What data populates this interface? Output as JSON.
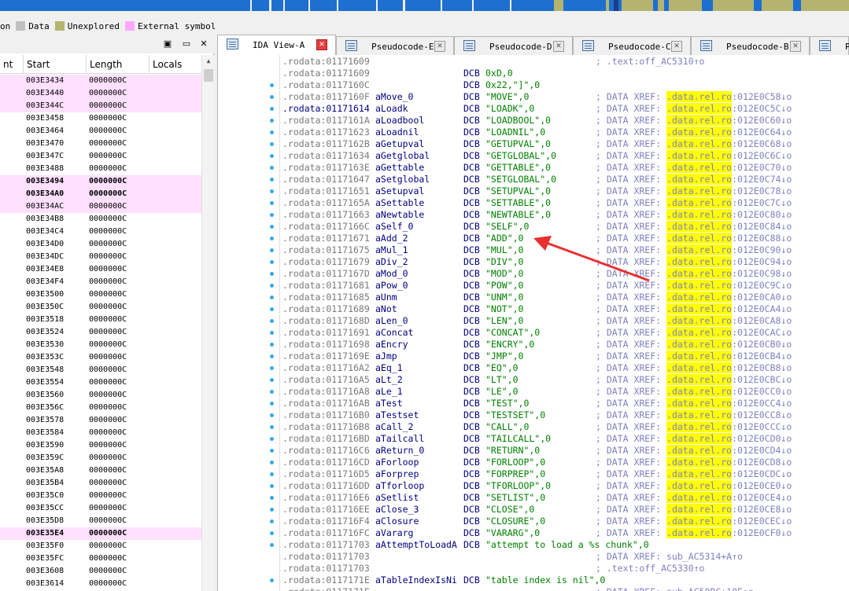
{
  "legend": [
    {
      "label": "on",
      "color": ""
    },
    {
      "label": "Data",
      "color": "#c0c0c0"
    },
    {
      "label": "Unexplored",
      "color": "#b5b370"
    },
    {
      "label": "External symbol",
      "color": "#ffa8ff"
    }
  ],
  "functions_panel": {
    "columns": [
      "nt",
      "Start",
      "Length",
      "Locals"
    ],
    "rows": [
      {
        "start": "003E3434",
        "length": "0000000C",
        "pink": true,
        "bold": false
      },
      {
        "start": "003E3440",
        "length": "0000000C",
        "pink": true,
        "bold": false
      },
      {
        "start": "003E344C",
        "length": "0000000C",
        "pink": true,
        "bold": false
      },
      {
        "start": "003E3458",
        "length": "0000000C",
        "pink": false,
        "bold": false
      },
      {
        "start": "003E3464",
        "length": "0000000C",
        "pink": false,
        "bold": false
      },
      {
        "start": "003E3470",
        "length": "0000000C",
        "pink": false,
        "bold": false
      },
      {
        "start": "003E347C",
        "length": "0000000C",
        "pink": false,
        "bold": false
      },
      {
        "start": "003E3488",
        "length": "0000000C",
        "pink": false,
        "bold": false
      },
      {
        "start": "003E3494",
        "length": "0000000C",
        "pink": true,
        "bold": true
      },
      {
        "start": "003E34A0",
        "length": "0000000C",
        "pink": true,
        "bold": true
      },
      {
        "start": "003E34AC",
        "length": "0000000C",
        "pink": true,
        "bold": false
      },
      {
        "start": "003E34B8",
        "length": "0000000C",
        "pink": false,
        "bold": false
      },
      {
        "start": "003E34C4",
        "length": "0000000C",
        "pink": false,
        "bold": false
      },
      {
        "start": "003E34D0",
        "length": "0000000C",
        "pink": false,
        "bold": false
      },
      {
        "start": "003E34DC",
        "length": "0000000C",
        "pink": false,
        "bold": false
      },
      {
        "start": "003E34E8",
        "length": "0000000C",
        "pink": false,
        "bold": false
      },
      {
        "start": "003E34F4",
        "length": "0000000C",
        "pink": false,
        "bold": false
      },
      {
        "start": "003E3500",
        "length": "0000000C",
        "pink": false,
        "bold": false
      },
      {
        "start": "003E350C",
        "length": "0000000C",
        "pink": false,
        "bold": false
      },
      {
        "start": "003E3518",
        "length": "0000000C",
        "pink": false,
        "bold": false
      },
      {
        "start": "003E3524",
        "length": "0000000C",
        "pink": false,
        "bold": false
      },
      {
        "start": "003E3530",
        "length": "0000000C",
        "pink": false,
        "bold": false
      },
      {
        "start": "003E353C",
        "length": "0000000C",
        "pink": false,
        "bold": false
      },
      {
        "start": "003E3548",
        "length": "0000000C",
        "pink": false,
        "bold": false
      },
      {
        "start": "003E3554",
        "length": "0000000C",
        "pink": false,
        "bold": false
      },
      {
        "start": "003E3560",
        "length": "0000000C",
        "pink": false,
        "bold": false
      },
      {
        "start": "003E356C",
        "length": "0000000C",
        "pink": false,
        "bold": false
      },
      {
        "start": "003E3578",
        "length": "0000000C",
        "pink": false,
        "bold": false
      },
      {
        "start": "003E3584",
        "length": "0000000C",
        "pink": false,
        "bold": false
      },
      {
        "start": "003E3590",
        "length": "0000000C",
        "pink": false,
        "bold": false
      },
      {
        "start": "003E359C",
        "length": "0000000C",
        "pink": false,
        "bold": false
      },
      {
        "start": "003E35A8",
        "length": "0000000C",
        "pink": false,
        "bold": false
      },
      {
        "start": "003E35B4",
        "length": "0000000C",
        "pink": false,
        "bold": false
      },
      {
        "start": "003E35C0",
        "length": "0000000C",
        "pink": false,
        "bold": false
      },
      {
        "start": "003E35CC",
        "length": "0000000C",
        "pink": false,
        "bold": false
      },
      {
        "start": "003E35D8",
        "length": "0000000C",
        "pink": false,
        "bold": false
      },
      {
        "start": "003E35E4",
        "length": "0000000C",
        "pink": true,
        "bold": true
      },
      {
        "start": "003E35F0",
        "length": "0000000C",
        "pink": false,
        "bold": false
      },
      {
        "start": "003E35FC",
        "length": "0000000C",
        "pink": false,
        "bold": false
      },
      {
        "start": "003E3608",
        "length": "0000000C",
        "pink": false,
        "bold": false
      },
      {
        "start": "003E3614",
        "length": "0000000C",
        "pink": false,
        "bold": false
      }
    ]
  },
  "panel_buttons": {
    "menu": "▣",
    "restore": "▭",
    "close": "✕"
  },
  "tabs": [
    {
      "label": "IDA View-A",
      "active": true
    },
    {
      "label": "Pseudocode-E",
      "active": false
    },
    {
      "label": "Pseudocode-D",
      "active": false
    },
    {
      "label": "Pseudocode-C",
      "active": false
    },
    {
      "label": "Pseudocode-B",
      "active": false
    },
    {
      "label": "Pseu",
      "active": false
    }
  ],
  "tab_close_glyph": "✕",
  "listing": [
    {
      "addr": ".rodata:01171609",
      "name": "",
      "ins": "",
      "op": "",
      "xref_pre": "; .text:off_AC5310↑o",
      "xref_hl": "",
      "xref_post": "",
      "bullet": false,
      "cur": false
    },
    {
      "addr": ".rodata:01171609",
      "name": "",
      "ins": "DCB",
      "op": "0xD,0",
      "xref_pre": "",
      "xref_hl": "",
      "xref_post": "",
      "bullet": false,
      "cur": false
    },
    {
      "addr": ".rodata:0117160C",
      "name": "",
      "ins": "DCB",
      "op": "0x22,\"]\",0",
      "xref_pre": "",
      "xref_hl": "",
      "xref_post": "",
      "bullet": true,
      "cur": false
    },
    {
      "addr": ".rodata:0117160F",
      "name": "aMove_0",
      "ins": "DCB",
      "op": "\"MOVE\",0",
      "xref_pre": "; DATA XREF: ",
      "xref_hl": ".data.rel.ro",
      "xref_post": ":012E0C58↓o",
      "bullet": true,
      "cur": false
    },
    {
      "addr": ".rodata:01171614",
      "name": "aLoadk",
      "ins": "DCB",
      "op": "\"LOADK\",0",
      "xref_pre": "; DATA XREF: ",
      "xref_hl": ".data.rel.ro",
      "xref_post": ":012E0C5C↓o",
      "bullet": true,
      "cur": true
    },
    {
      "addr": ".rodata:0117161A",
      "name": "aLoadbool",
      "ins": "DCB",
      "op": "\"LOADBOOL\",0",
      "xref_pre": "; DATA XREF: ",
      "xref_hl": ".data.rel.ro",
      "xref_post": ":012E0C60↓o",
      "bullet": true,
      "cur": false
    },
    {
      "addr": ".rodata:01171623",
      "name": "aLoadnil",
      "ins": "DCB",
      "op": "\"LOADNIL\",0",
      "xref_pre": "; DATA XREF: ",
      "xref_hl": ".data.rel.ro",
      "xref_post": ":012E0C64↓o",
      "bullet": true,
      "cur": false
    },
    {
      "addr": ".rodata:0117162B",
      "name": "aGetupval",
      "ins": "DCB",
      "op": "\"GETUPVAL\",0",
      "xref_pre": "; DATA XREF: ",
      "xref_hl": ".data.rel.ro",
      "xref_post": ":012E0C68↓o",
      "bullet": true,
      "cur": false
    },
    {
      "addr": ".rodata:01171634",
      "name": "aGetglobal",
      "ins": "DCB",
      "op": "\"GETGLOBAL\",0",
      "xref_pre": "; DATA XREF: ",
      "xref_hl": ".data.rel.ro",
      "xref_post": ":012E0C6C↓o",
      "bullet": true,
      "cur": false
    },
    {
      "addr": ".rodata:0117163E",
      "name": "aGettable",
      "ins": "DCB",
      "op": "\"GETTABLE\",0",
      "xref_pre": "; DATA XREF: ",
      "xref_hl": ".data.rel.ro",
      "xref_post": ":012E0C70↓o",
      "bullet": true,
      "cur": false
    },
    {
      "addr": ".rodata:01171647",
      "name": "aSetglobal",
      "ins": "DCB",
      "op": "\"SETGLOBAL\",0",
      "xref_pre": "; DATA XREF: ",
      "xref_hl": ".data.rel.ro",
      "xref_post": ":012E0C74↓o",
      "bullet": true,
      "cur": false
    },
    {
      "addr": ".rodata:01171651",
      "name": "aSetupval",
      "ins": "DCB",
      "op": "\"SETUPVAL\",0",
      "xref_pre": "; DATA XREF: ",
      "xref_hl": ".data.rel.ro",
      "xref_post": ":012E0C78↓o",
      "bullet": true,
      "cur": false
    },
    {
      "addr": ".rodata:0117165A",
      "name": "aSettable",
      "ins": "DCB",
      "op": "\"SETTABLE\",0",
      "xref_pre": "; DATA XREF: ",
      "xref_hl": ".data.rel.ro",
      "xref_post": ":012E0C7C↓o",
      "bullet": true,
      "cur": false
    },
    {
      "addr": ".rodata:01171663",
      "name": "aNewtable",
      "ins": "DCB",
      "op": "\"NEWTABLE\",0",
      "xref_pre": "; DATA XREF: ",
      "xref_hl": ".data.rel.ro",
      "xref_post": ":012E0C80↓o",
      "bullet": true,
      "cur": false
    },
    {
      "addr": ".rodata:0117166C",
      "name": "aSelf_0",
      "ins": "DCB",
      "op": "\"SELF\",0",
      "xref_pre": "; DATA XREF: ",
      "xref_hl": ".data.rel.ro",
      "xref_post": ":012E0C84↓o",
      "bullet": true,
      "cur": false
    },
    {
      "addr": ".rodata:01171671",
      "name": "aAdd_2",
      "ins": "DCB",
      "op": "\"ADD\",0",
      "xref_pre": "; DATA XREF: ",
      "xref_hl": ".data.rel.ro",
      "xref_post": ":012E0C88↓o",
      "bullet": true,
      "cur": false
    },
    {
      "addr": ".rodata:01171675",
      "name": "aMul_1",
      "ins": "DCB",
      "op": "\"MUL\",0",
      "xref_pre": "; DATA XREF: ",
      "xref_hl": ".data.rel.ro",
      "xref_post": ":012E0C90↓o",
      "bullet": true,
      "cur": false
    },
    {
      "addr": ".rodata:01171679",
      "name": "aDiv_2",
      "ins": "DCB",
      "op": "\"DIV\",0",
      "xref_pre": "; DATA XREF: ",
      "xref_hl": ".data.rel.ro",
      "xref_post": ":012E0C94↓o",
      "bullet": true,
      "cur": false
    },
    {
      "addr": ".rodata:0117167D",
      "name": "aMod_0",
      "ins": "DCB",
      "op": "\"MOD\",0",
      "xref_pre": "; DATA XREF: ",
      "xref_hl": ".data.rel.ro",
      "xref_post": ":012E0C98↓o",
      "bullet": true,
      "cur": false
    },
    {
      "addr": ".rodata:01171681",
      "name": "aPow_0",
      "ins": "DCB",
      "op": "\"POW\",0",
      "xref_pre": "; DATA XREF: ",
      "xref_hl": ".data.rel.ro",
      "xref_post": ":012E0C9C↓o",
      "bullet": true,
      "cur": false
    },
    {
      "addr": ".rodata:01171685",
      "name": "aUnm",
      "ins": "DCB",
      "op": "\"UNM\",0",
      "xref_pre": "; DATA XREF: ",
      "xref_hl": ".data.rel.ro",
      "xref_post": ":012E0CA0↓o",
      "bullet": true,
      "cur": false
    },
    {
      "addr": ".rodata:01171689",
      "name": "aNot",
      "ins": "DCB",
      "op": "\"NOT\",0",
      "xref_pre": "; DATA XREF: ",
      "xref_hl": ".data.rel.ro",
      "xref_post": ":012E0CA4↓o",
      "bullet": true,
      "cur": false
    },
    {
      "addr": ".rodata:0117168D",
      "name": "aLen_0",
      "ins": "DCB",
      "op": "\"LEN\",0",
      "xref_pre": "; DATA XREF: ",
      "xref_hl": ".data.rel.ro",
      "xref_post": ":012E0CA8↓o",
      "bullet": true,
      "cur": false
    },
    {
      "addr": ".rodata:01171691",
      "name": "aConcat",
      "ins": "DCB",
      "op": "\"CONCAT\",0",
      "xref_pre": "; DATA XREF: ",
      "xref_hl": ".data.rel.ro",
      "xref_post": ":012E0CAC↓o",
      "bullet": true,
      "cur": false
    },
    {
      "addr": ".rodata:01171698",
      "name": "aEncry",
      "ins": "DCB",
      "op": "\"ENCRY\",0",
      "xref_pre": "; DATA XREF: ",
      "xref_hl": ".data.rel.ro",
      "xref_post": ":012E0CB0↓o",
      "bullet": true,
      "cur": false
    },
    {
      "addr": ".rodata:0117169E",
      "name": "aJmp",
      "ins": "DCB",
      "op": "\"JMP\",0",
      "xref_pre": "; DATA XREF: ",
      "xref_hl": ".data.rel.ro",
      "xref_post": ":012E0CB4↓o",
      "bullet": true,
      "cur": false
    },
    {
      "addr": ".rodata:011716A2",
      "name": "aEq_1",
      "ins": "DCB",
      "op": "\"EQ\",0",
      "xref_pre": "; DATA XREF: ",
      "xref_hl": ".data.rel.ro",
      "xref_post": ":012E0CB8↓o",
      "bullet": true,
      "cur": false
    },
    {
      "addr": ".rodata:011716A5",
      "name": "aLt_2",
      "ins": "DCB",
      "op": "\"LT\",0",
      "xref_pre": "; DATA XREF: ",
      "xref_hl": ".data.rel.ro",
      "xref_post": ":012E0CBC↓o",
      "bullet": true,
      "cur": false
    },
    {
      "addr": ".rodata:011716A8",
      "name": "aLe_1",
      "ins": "DCB",
      "op": "\"LE\",0",
      "xref_pre": "; DATA XREF: ",
      "xref_hl": ".data.rel.ro",
      "xref_post": ":012E0CC0↓o",
      "bullet": true,
      "cur": false
    },
    {
      "addr": ".rodata:011716AB",
      "name": "aTest",
      "ins": "DCB",
      "op": "\"TEST\",0",
      "xref_pre": "; DATA XREF: ",
      "xref_hl": ".data.rel.ro",
      "xref_post": ":012E0CC4↓o",
      "bullet": true,
      "cur": false
    },
    {
      "addr": ".rodata:011716B0",
      "name": "aTestset",
      "ins": "DCB",
      "op": "\"TESTSET\",0",
      "xref_pre": "; DATA XREF: ",
      "xref_hl": ".data.rel.ro",
      "xref_post": ":012E0CC8↓o",
      "bullet": true,
      "cur": false
    },
    {
      "addr": ".rodata:011716B8",
      "name": "aCall_2",
      "ins": "DCB",
      "op": "\"CALL\",0",
      "xref_pre": "; DATA XREF: ",
      "xref_hl": ".data.rel.ro",
      "xref_post": ":012E0CCC↓o",
      "bullet": true,
      "cur": false
    },
    {
      "addr": ".rodata:011716BD",
      "name": "aTailcall",
      "ins": "DCB",
      "op": "\"TAILCALL\",0",
      "xref_pre": "; DATA XREF: ",
      "xref_hl": ".data.rel.ro",
      "xref_post": ":012E0CD0↓o",
      "bullet": true,
      "cur": false
    },
    {
      "addr": ".rodata:011716C6",
      "name": "aReturn_0",
      "ins": "DCB",
      "op": "\"RETURN\",0",
      "xref_pre": "; DATA XREF: ",
      "xref_hl": ".data.rel.ro",
      "xref_post": ":012E0CD4↓o",
      "bullet": true,
      "cur": false
    },
    {
      "addr": ".rodata:011716CD",
      "name": "aForloop",
      "ins": "DCB",
      "op": "\"FORLOOP\",0",
      "xref_pre": "; DATA XREF: ",
      "xref_hl": ".data.rel.ro",
      "xref_post": ":012E0CD8↓o",
      "bullet": true,
      "cur": false
    },
    {
      "addr": ".rodata:011716D5",
      "name": "aForprep",
      "ins": "DCB",
      "op": "\"FORPREP\",0",
      "xref_pre": "; DATA XREF: ",
      "xref_hl": ".data.rel.ro",
      "xref_post": ":012E0CDC↓o",
      "bullet": true,
      "cur": false
    },
    {
      "addr": ".rodata:011716DD",
      "name": "aTforloop",
      "ins": "DCB",
      "op": "\"TFORLOOP\",0",
      "xref_pre": "; DATA XREF: ",
      "xref_hl": ".data.rel.ro",
      "xref_post": ":012E0CE0↓o",
      "bullet": true,
      "cur": false
    },
    {
      "addr": ".rodata:011716E6",
      "name": "aSetlist",
      "ins": "DCB",
      "op": "\"SETLIST\",0",
      "xref_pre": "; DATA XREF: ",
      "xref_hl": ".data.rel.ro",
      "xref_post": ":012E0CE4↓o",
      "bullet": true,
      "cur": false
    },
    {
      "addr": ".rodata:011716EE",
      "name": "aClose_3",
      "ins": "DCB",
      "op": "\"CLOSE\",0",
      "xref_pre": "; DATA XREF: ",
      "xref_hl": ".data.rel.ro",
      "xref_post": ":012E0CE8↓o",
      "bullet": true,
      "cur": false
    },
    {
      "addr": ".rodata:011716F4",
      "name": "aClosure",
      "ins": "DCB",
      "op": "\"CLOSURE\",0",
      "xref_pre": "; DATA XREF: ",
      "xref_hl": ".data.rel.ro",
      "xref_post": ":012E0CEC↓o",
      "bullet": true,
      "cur": false
    },
    {
      "addr": ".rodata:011716FC",
      "name": "aVararg",
      "ins": "DCB",
      "op": "\"VARARG\",0",
      "xref_pre": "; DATA XREF: ",
      "xref_hl": ".data.rel.ro",
      "xref_post": ":012E0CF0↓o",
      "bullet": true,
      "cur": false
    },
    {
      "addr": ".rodata:01171703",
      "name": "aAttemptToLoadA",
      "ins": "DCB",
      "op": "\"attempt to load a %s chunk\",0",
      "xref_pre": "",
      "xref_hl": "",
      "xref_post": "",
      "bullet": true,
      "cur": false
    },
    {
      "addr": ".rodata:01171703",
      "name": "",
      "ins": "",
      "op": "",
      "xref_pre": "; DATA XREF: sub_AC5314+A↑o",
      "xref_hl": "",
      "xref_post": "",
      "bullet": false,
      "cur": false
    },
    {
      "addr": ".rodata:01171703",
      "name": "",
      "ins": "",
      "op": "",
      "xref_pre": "; .text:off_AC5330↑o",
      "xref_hl": "",
      "xref_post": "",
      "bullet": false,
      "cur": false
    },
    {
      "addr": ".rodata:0117171E",
      "name": "aTableIndexIsNi",
      "ins": "DCB",
      "op": "\"table index is nil\",0",
      "xref_pre": "",
      "xref_hl": "",
      "xref_post": "",
      "bullet": true,
      "cur": false
    },
    {
      "addr": ".rodata:0117171E",
      "name": "",
      "ins": "",
      "op": "",
      "xref_pre": "; DATA XREF: sub_AC50BC+18E↑o",
      "xref_hl": "",
      "xref_post": "",
      "bullet": false,
      "cur": false
    }
  ],
  "annotation_arrow": {
    "color": "#e83030"
  }
}
